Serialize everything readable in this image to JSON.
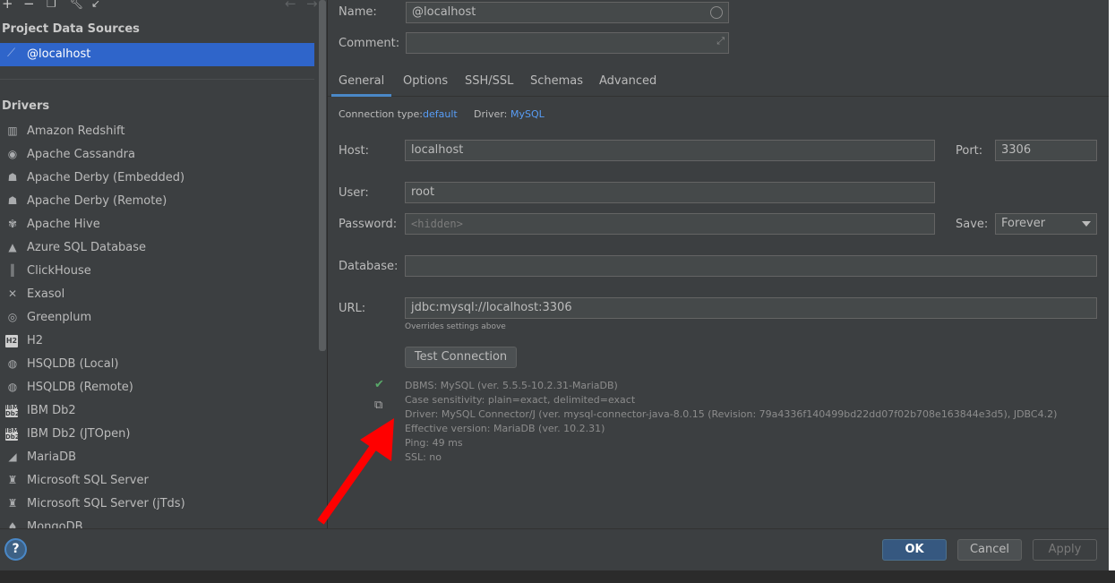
{
  "toolbar": {
    "icons": [
      "add-icon",
      "remove-icon",
      "duplicate-icon",
      "wrench-icon",
      "jump-icon",
      "back-icon",
      "forward-icon"
    ]
  },
  "left": {
    "project_title": "Project Data Sources",
    "datasource": "@localhost",
    "drivers_title": "Drivers",
    "drivers": [
      "Amazon Redshift",
      "Apache Cassandra",
      "Apache Derby (Embedded)",
      "Apache Derby (Remote)",
      "Apache Hive",
      "Azure SQL Database",
      "ClickHouse",
      "Exasol",
      "Greenplum",
      "H2",
      "HSQLDB (Local)",
      "HSQLDB (Remote)",
      "IBM Db2",
      "IBM Db2 (JTOpen)",
      "MariaDB",
      "Microsoft SQL Server",
      "Microsoft SQL Server (jTds)",
      "MongoDB"
    ],
    "db2_badge": "IBM\nDb2",
    "h2_badge": "H2"
  },
  "form": {
    "name_label": "Name:",
    "name_value": "@localhost",
    "comment_label": "Comment:",
    "comment_value": "",
    "tabs": [
      "General",
      "Options",
      "SSH/SSL",
      "Schemas",
      "Advanced"
    ],
    "conn_type_label": "Connection type:",
    "conn_type_value": "default",
    "driver_label": "Driver:",
    "driver_value": "MySQL",
    "host_label": "Host:",
    "host_value": "localhost",
    "port_label": "Port:",
    "port_value": "3306",
    "user_label": "User:",
    "user_value": "root",
    "password_label": "Password:",
    "password_placeholder": "<hidden>",
    "save_label": "Save:",
    "save_value": "Forever",
    "database_label": "Database:",
    "database_value": "",
    "url_label": "URL:",
    "url_value": "jdbc:mysql://localhost:3306",
    "url_hint": "Overrides settings above",
    "test_button": "Test Connection",
    "results": [
      "DBMS: MySQL (ver. 5.5.5-10.2.31-MariaDB)",
      "Case sensitivity: plain=exact, delimited=exact",
      "Driver: MySQL Connector/J (ver. mysql-connector-java-8.0.15 (Revision: 79a4336f140499bd22dd07f02b708e163844e3d5), JDBC4.2)",
      "Effective version: MariaDB (ver. 10.2.31)",
      "Ping: 49 ms",
      "SSL: no"
    ]
  },
  "footer": {
    "help": "?",
    "ok": "OK",
    "cancel": "Cancel",
    "apply": "Apply"
  },
  "colors": {
    "selection": "#2f65ca",
    "link": "#589df6",
    "success": "#59a869",
    "annotation_arrow": "#ff0000"
  }
}
